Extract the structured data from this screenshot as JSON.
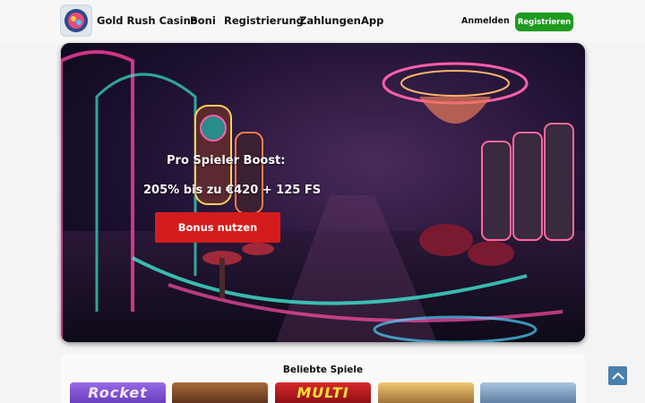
{
  "header": {
    "brand": "Gold Rush Casino",
    "nav": [
      "Boni",
      "Registrierung",
      "Zahlungen",
      "App"
    ],
    "login": "Anmelden",
    "register": "Registrieren"
  },
  "hero": {
    "line1": "Pro Spieler Boost:",
    "line2": "205% bis zu €420 + 125 FS",
    "cta": "Bonus nutzen"
  },
  "games": {
    "title": "Beliebte Spiele",
    "tiles": [
      {
        "label": "Rocket",
        "color": "#7b4fd6"
      },
      {
        "label": "",
        "color": "#6a3a22"
      },
      {
        "label": "MULTI",
        "color": "#b8141a"
      },
      {
        "label": "",
        "color": "#c79a3a"
      },
      {
        "label": "",
        "color": "#6d8fb3"
      }
    ]
  },
  "colors": {
    "register": "#1e9a1e",
    "cta": "#d51c1c",
    "scroll_top": "#4a7fae"
  },
  "icons": [
    "casino-logo-icon",
    "chevron-up-icon"
  ]
}
